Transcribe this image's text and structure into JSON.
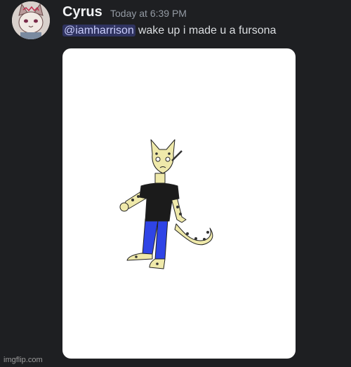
{
  "message": {
    "author": "Cyrus",
    "timestamp": "Today at 6:39 PM",
    "mention": "@iamharrison",
    "text": "wake up i made u a fursona"
  },
  "attachment": {
    "type": "image",
    "subject": "drawing of a cheetah-like cat character in a black t-shirt and blue jeans"
  },
  "watermark": "imgflip.com",
  "colors": {
    "background": "#1e1f22",
    "username": "#f2f3f5",
    "timestamp": "#949ba4",
    "message_text": "#dbdee1",
    "mention_text": "#c9cdfb"
  }
}
